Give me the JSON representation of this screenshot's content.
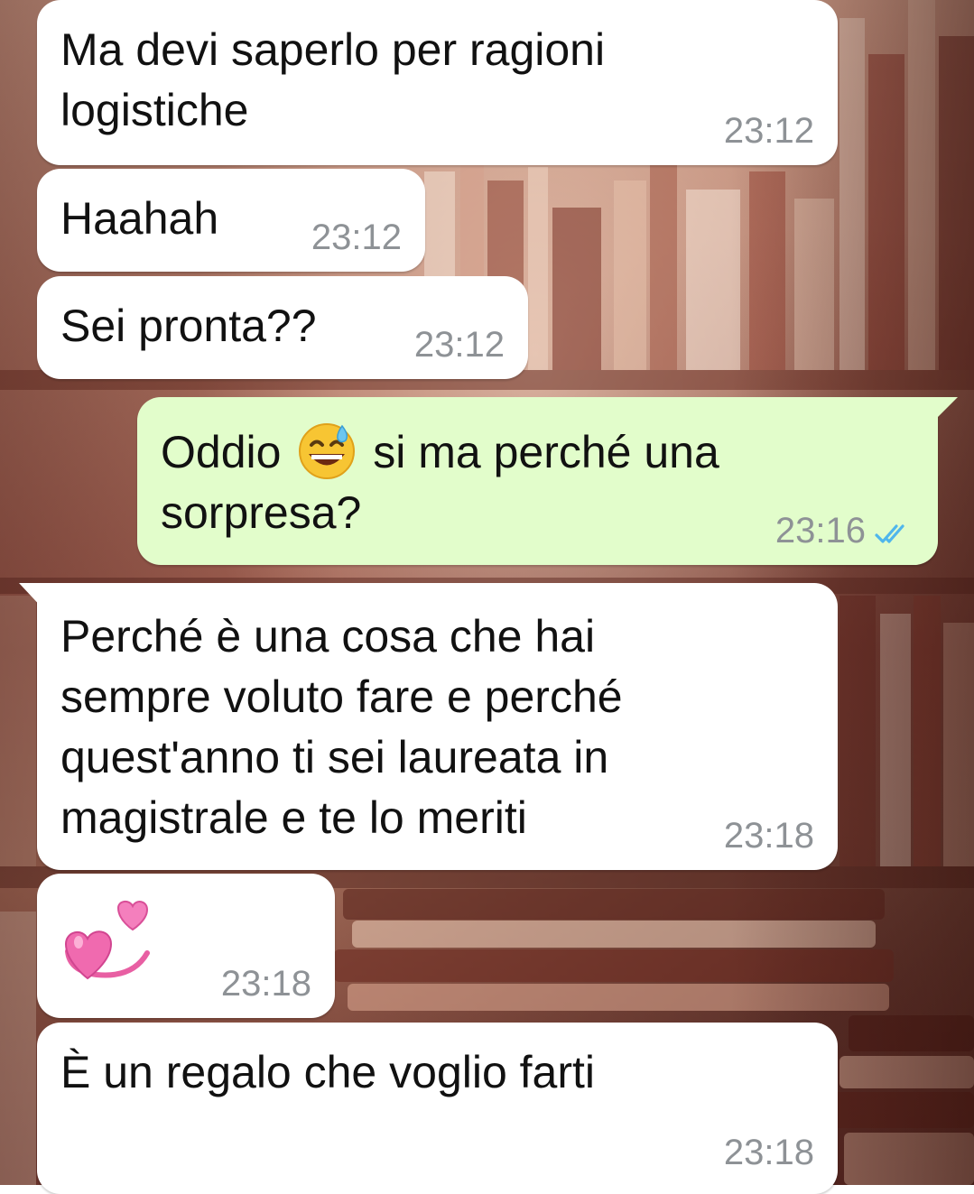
{
  "colors": {
    "incoming_bubble": "#ffffff",
    "outgoing_bubble": "#e2fdcb",
    "timestamp": "#8e9296",
    "read_ticks": "#4fb6ec"
  },
  "messages": [
    {
      "direction": "incoming",
      "text": "Ma devi saperlo per ragioni\nlogistiche",
      "time": "23:12"
    },
    {
      "direction": "incoming",
      "text": "Haahah",
      "time": "23:12"
    },
    {
      "direction": "incoming",
      "text": "Sei pronta??",
      "time": "23:12"
    },
    {
      "direction": "outgoing",
      "text_before": "Oddio",
      "emoji": "grinning-face-with-sweat-icon",
      "text_after": "si ma perché una\nsorpresa?",
      "time": "23:16",
      "status": "read"
    },
    {
      "direction": "incoming",
      "text": "Perché è una cosa che hai\nsempre voluto fare e perché\nquest'anno ti sei laureata in\nmagistrale e te lo meriti",
      "time": "23:18"
    },
    {
      "direction": "incoming",
      "emoji": "revolving-hearts-icon",
      "time": "23:18"
    },
    {
      "direction": "incoming",
      "text": "È un regalo che voglio farti",
      "time": "23:18"
    }
  ]
}
